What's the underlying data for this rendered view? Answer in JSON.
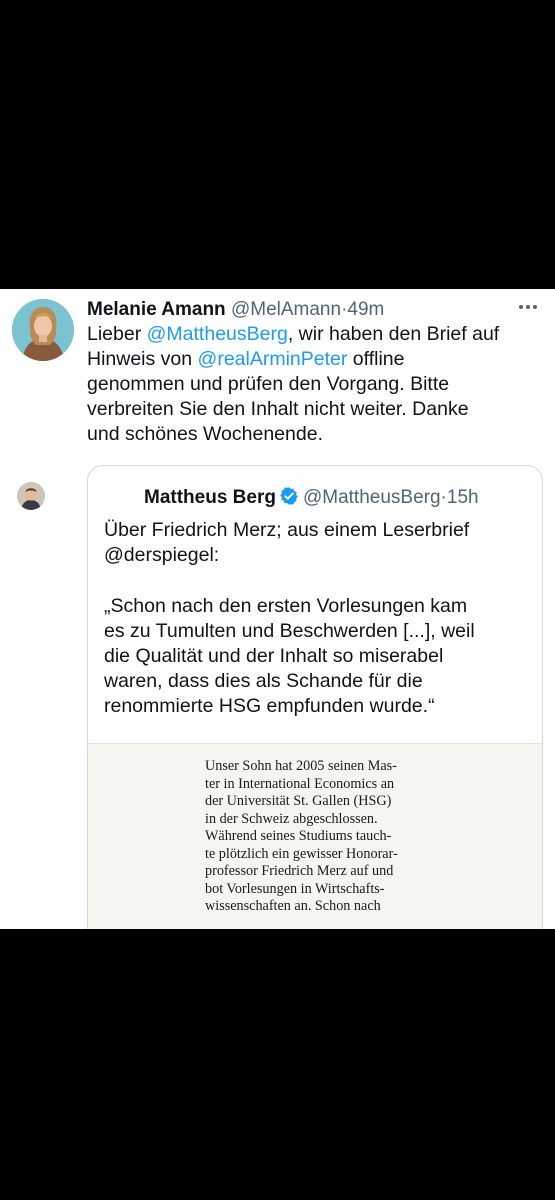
{
  "tweet": {
    "author_name": "Melanie Amann",
    "handle": "@MelAmann",
    "separator": "·",
    "time": "49m",
    "text_lines": [
      [
        {
          "t": "Lieber "
        },
        {
          "t": "@MattheusBerg",
          "mention": true
        },
        {
          "t": ", wir haben den Brief auf"
        }
      ],
      [
        {
          "t": "Hinweis von "
        },
        {
          "t": "@realArminPeter",
          "mention": true
        },
        {
          "t": " offline"
        }
      ],
      [
        {
          "t": "genommen und prüfen den Vorgang. Bitte"
        }
      ],
      [
        {
          "t": "verbreiten Sie den Inhalt nicht weiter. Danke"
        }
      ],
      [
        {
          "t": "und schönes Wochenende."
        }
      ]
    ]
  },
  "quoted_tweet": {
    "author_name": "Mattheus Berg",
    "handle": "@MattheusBerg",
    "separator": "·",
    "time": "15h",
    "text_lines": [
      "Über Friedrich Merz; aus einem Leserbrief",
      "@derspiegel:",
      "",
      "„Schon nach den ersten Vorlesungen kam",
      "es zu Tumulten und Beschwerden [...], weil",
      "die Qualität und der Inhalt so miserabel",
      "waren, dass dies als Schande für die",
      "renommierte HSG empfunden wurde.“"
    ],
    "image_text_lines": [
      "Unser Sohn hat 2005 seinen Mas-",
      "ter in International Economics an",
      "der Universität St. Gallen (HSG)",
      "in der Schweiz abgeschlossen.",
      "Während seines Studiums tauch-",
      "te plötzlich ein gewisser Honorar-",
      "professor Friedrich Merz auf und",
      "bot Vorlesungen in Wirtschafts-",
      "wissenschaften an. Schon nach"
    ]
  },
  "colors": {
    "mention": "#1d9bf0",
    "verified": "#1d9bf0",
    "secondary_text": "#536471"
  },
  "icons": {
    "more": "more-horizontal-icon",
    "verified": "verified-badge-icon"
  }
}
